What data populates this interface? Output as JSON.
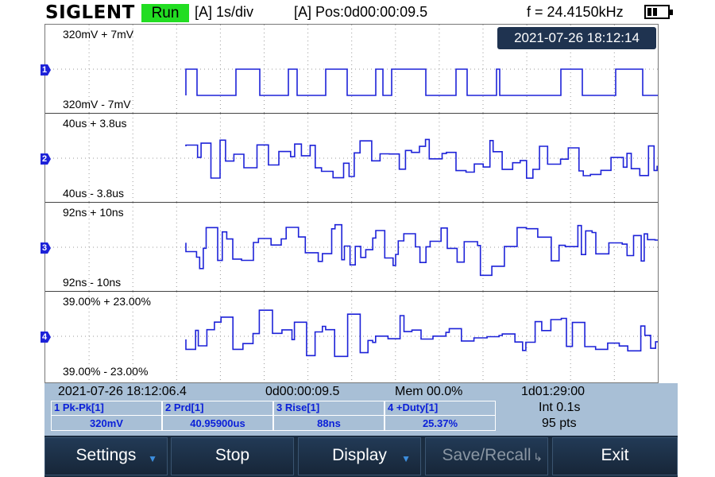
{
  "header": {
    "brand": "SIGLENT",
    "run_state": "Run",
    "timebase": "[A] 1s/div",
    "position": "[A] Pos:0d00:00:09.5",
    "frequency": "f = 24.4150kHz"
  },
  "screen": {
    "datetime": "2021-07-26 18:12:14",
    "panels": [
      {
        "channel": "1",
        "top_label": "320mV + 7mV",
        "bottom_label": "320mV - 7mV"
      },
      {
        "channel": "2",
        "top_label": "40us + 3.8us",
        "bottom_label": "40us - 3.8us"
      },
      {
        "channel": "3",
        "top_label": "92ns + 10ns",
        "bottom_label": "92ns - 10ns"
      },
      {
        "channel": "4",
        "top_label": "39.00% + 23.00%",
        "bottom_label": "39.00% - 23.00%"
      }
    ]
  },
  "stats": {
    "start_time": "2021-07-26 18:12:06.4",
    "duration": "0d00:00:09.5",
    "memory": "Mem 00.0%",
    "elapsed": "1d01:29:00",
    "interval": "Int 0.1s",
    "points": "95 pts",
    "measurements": [
      {
        "num": "1",
        "name": "Pk-Pk[1]",
        "value": "320mV"
      },
      {
        "num": "2",
        "name": "Prd[1]",
        "value": "40.95900us"
      },
      {
        "num": "3",
        "name": "Rise[1]",
        "value": "88ns"
      },
      {
        "num": "4",
        "name": "+Duty[1]",
        "value": "25.37%"
      }
    ]
  },
  "softkeys": {
    "settings": "Settings",
    "stop": "Stop",
    "display": "Display",
    "save_recall": "Save/Recall",
    "exit": "Exit"
  },
  "colors": {
    "trace": "#1d22d8",
    "run_green": "#22dd22",
    "stats_bg": "#a8bfd6",
    "softkey_bg": "#1a2c40"
  }
}
